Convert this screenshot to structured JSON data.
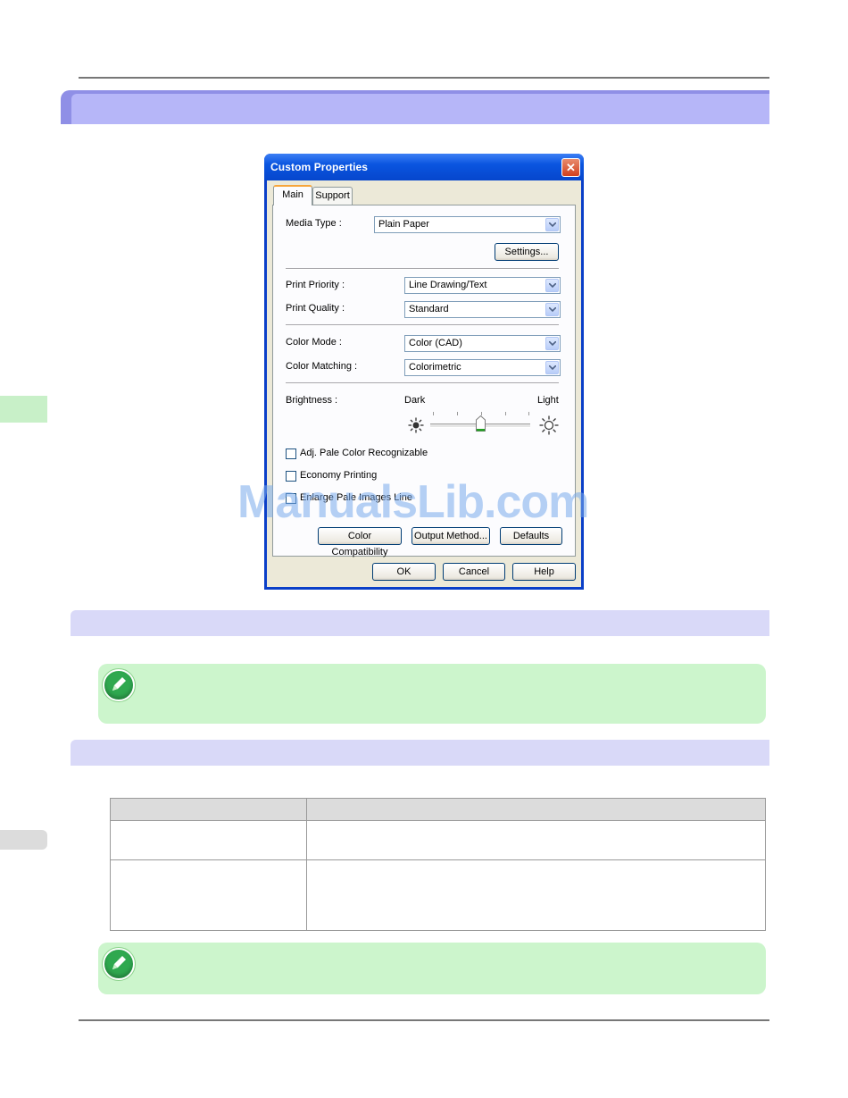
{
  "dialog": {
    "title": "Custom Properties",
    "close_label": "✕",
    "tabs": [
      {
        "label": "Main",
        "active": true
      },
      {
        "label": "Support",
        "active": false
      }
    ],
    "media_type": {
      "label": "Media Type :",
      "value": "Plain Paper"
    },
    "settings_button": "Settings...",
    "print_priority": {
      "label": "Print Priority :",
      "value": "Line Drawing/Text"
    },
    "print_quality": {
      "label": "Print Quality :",
      "value": "Standard"
    },
    "color_mode": {
      "label": "Color Mode :",
      "value": "Color (CAD)"
    },
    "color_matching": {
      "label": "Color Matching :",
      "value": "Colorimetric"
    },
    "brightness": {
      "label": "Brightness :",
      "dark_label": "Dark",
      "light_label": "Light",
      "level_fraction": 0.5
    },
    "checkboxes": [
      {
        "label": "Adj. Pale Color Recognizable",
        "checked": false
      },
      {
        "label": "Economy Printing",
        "checked": false
      },
      {
        "label": "Enlarge Pale Images Line",
        "checked": false
      }
    ],
    "buttons": {
      "color_compatibility": "Color Compatibility",
      "output_method": "Output Method...",
      "defaults": "Defaults",
      "ok": "OK",
      "cancel": "Cancel",
      "help": "Help"
    }
  },
  "watermark": "ManualsLib.com",
  "colors": {
    "chapter_bar": "#b6b6f8",
    "section_bar": "#d9d9f8",
    "note_bg": "#ccf5cc",
    "note_icon": "#2fa84f",
    "titlebar": "#0a55e0"
  }
}
